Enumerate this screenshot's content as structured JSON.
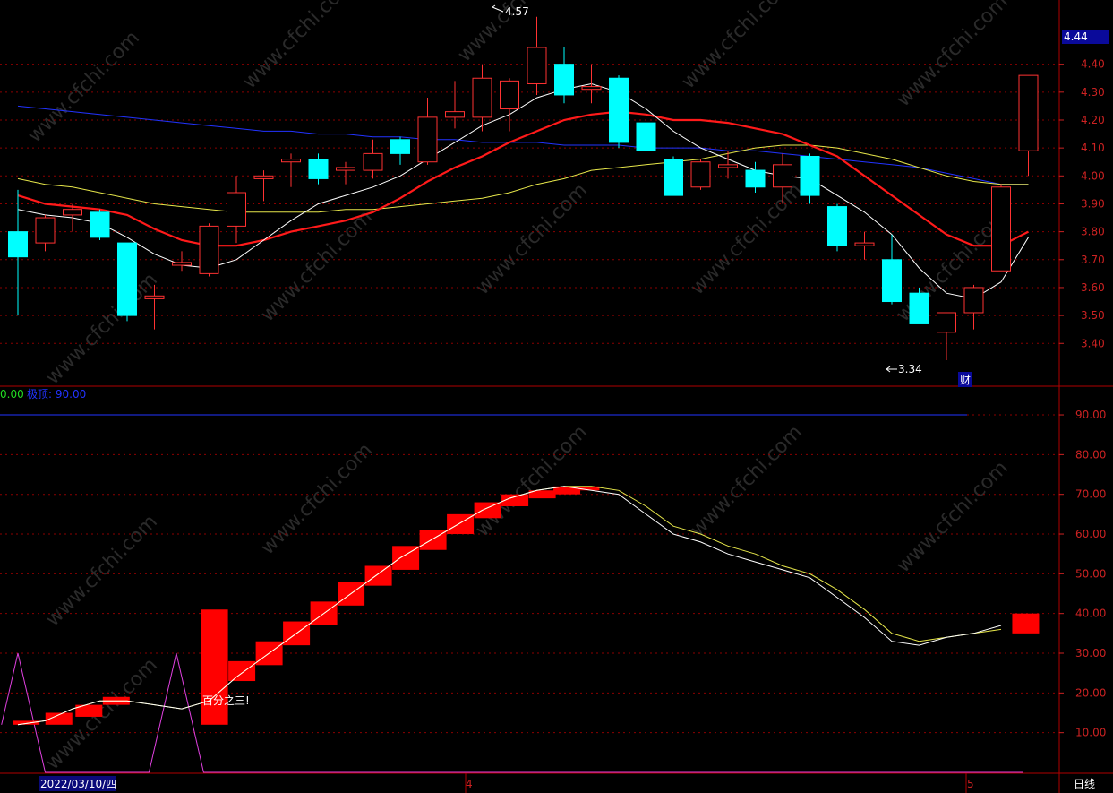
{
  "colors": {
    "background": "#000000",
    "up": "#ff3232",
    "down": "#00ffff",
    "ma_white": "#ffffff",
    "ma_red": "#ff1a1a",
    "ma_yellow": "#e6e64a",
    "ma_blue": "#2233ff",
    "grid": "#8b0000",
    "axis_text": "#cc2222",
    "indicator_line": "#e6e64a",
    "indicator_magenta": "#e040e0",
    "indicator_limit": "#2233ff",
    "bars": "#ff0000"
  },
  "price_panel": {
    "current_price": "4.44",
    "high_marker": "4.57",
    "low_marker": "3.34",
    "finance_badge": "财"
  },
  "indicator_panel": {
    "header_value": "0.00",
    "header_limit_label": "极顶: 90.00",
    "annotation": "百分之三!"
  },
  "bottom_bar": {
    "date_label": "2022/03/10/四",
    "month_4": "4",
    "month_5": "5",
    "period": "日线"
  },
  "chart_data": [
    {
      "type": "candlestick",
      "ylim": [
        3.25,
        4.63
      ],
      "yticks": [
        "4.40",
        "4.30",
        "4.20",
        "4.10",
        "4.00",
        "3.90",
        "3.80",
        "3.70",
        "3.60",
        "3.50",
        "3.40"
      ],
      "candles": [
        {
          "o": 3.8,
          "c": 3.71,
          "h": 3.95,
          "l": 3.5
        },
        {
          "o": 3.76,
          "c": 3.85,
          "h": 3.86,
          "l": 3.73
        },
        {
          "o": 3.86,
          "c": 3.88,
          "h": 3.9,
          "l": 3.8
        },
        {
          "o": 3.87,
          "c": 3.78,
          "h": 3.88,
          "l": 3.77
        },
        {
          "o": 3.76,
          "c": 3.5,
          "h": 3.76,
          "l": 3.48
        },
        {
          "o": 3.56,
          "c": 3.57,
          "h": 3.61,
          "l": 3.45
        },
        {
          "o": 3.68,
          "c": 3.69,
          "h": 3.73,
          "l": 3.66
        },
        {
          "o": 3.65,
          "c": 3.82,
          "h": 3.83,
          "l": 3.64
        },
        {
          "o": 3.82,
          "c": 3.94,
          "h": 4.0,
          "l": 3.76
        },
        {
          "o": 3.99,
          "c": 4.0,
          "h": 4.02,
          "l": 3.91
        },
        {
          "o": 4.05,
          "c": 4.06,
          "h": 4.08,
          "l": 3.96
        },
        {
          "o": 4.06,
          "c": 3.99,
          "h": 4.08,
          "l": 3.97
        },
        {
          "o": 4.02,
          "c": 4.03,
          "h": 4.05,
          "l": 3.97
        },
        {
          "o": 4.02,
          "c": 4.08,
          "h": 4.13,
          "l": 3.99
        },
        {
          "o": 4.13,
          "c": 4.08,
          "h": 4.14,
          "l": 4.04
        },
        {
          "o": 4.05,
          "c": 4.21,
          "h": 4.28,
          "l": 4.04
        },
        {
          "o": 4.21,
          "c": 4.23,
          "h": 4.34,
          "l": 4.17
        },
        {
          "o": 4.21,
          "c": 4.35,
          "h": 4.4,
          "l": 4.16
        },
        {
          "o": 4.24,
          "c": 4.34,
          "h": 4.35,
          "l": 4.16
        },
        {
          "o": 4.33,
          "c": 4.46,
          "h": 4.57,
          "l": 4.29
        },
        {
          "o": 4.4,
          "c": 4.29,
          "h": 4.46,
          "l": 4.26
        },
        {
          "o": 4.31,
          "c": 4.32,
          "h": 4.4,
          "l": 4.26
        },
        {
          "o": 4.35,
          "c": 4.12,
          "h": 4.36,
          "l": 4.1
        },
        {
          "o": 4.19,
          "c": 4.09,
          "h": 4.2,
          "l": 4.06
        },
        {
          "o": 4.06,
          "c": 3.93,
          "h": 4.07,
          "l": 3.93
        },
        {
          "o": 3.96,
          "c": 4.05,
          "h": 4.06,
          "l": 3.95
        },
        {
          "o": 4.03,
          "c": 4.04,
          "h": 4.09,
          "l": 3.99
        },
        {
          "o": 4.02,
          "c": 3.96,
          "h": 4.05,
          "l": 3.94
        },
        {
          "o": 3.96,
          "c": 4.04,
          "h": 4.08,
          "l": 3.9
        },
        {
          "o": 4.07,
          "c": 3.93,
          "h": 4.08,
          "l": 3.9
        },
        {
          "o": 3.89,
          "c": 3.75,
          "h": 3.9,
          "l": 3.73
        },
        {
          "o": 3.75,
          "c": 3.76,
          "h": 3.8,
          "l": 3.7
        },
        {
          "o": 3.7,
          "c": 3.55,
          "h": 3.79,
          "l": 3.54
        },
        {
          "o": 3.58,
          "c": 3.47,
          "h": 3.6,
          "l": 3.47
        },
        {
          "o": 3.44,
          "c": 3.51,
          "h": 3.51,
          "l": 3.34
        },
        {
          "o": 3.51,
          "c": 3.6,
          "h": 3.61,
          "l": 3.45
        },
        {
          "o": 3.66,
          "c": 3.96,
          "h": 3.97,
          "l": 3.66
        },
        {
          "o": 4.09,
          "c": 4.36,
          "h": 4.36,
          "l": 4.0
        }
      ],
      "ma_white": [
        3.88,
        3.86,
        3.85,
        3.83,
        3.78,
        3.72,
        3.68,
        3.67,
        3.7,
        3.77,
        3.84,
        3.9,
        3.93,
        3.96,
        4.0,
        4.06,
        4.12,
        4.18,
        4.22,
        4.28,
        4.31,
        4.33,
        4.3,
        4.24,
        4.16,
        4.1,
        4.06,
        4.02,
        4.0,
        3.99,
        3.93,
        3.87,
        3.79,
        3.67,
        3.58,
        3.56,
        3.62,
        3.78
      ],
      "ma_red": [
        3.93,
        3.9,
        3.89,
        3.88,
        3.86,
        3.81,
        3.77,
        3.75,
        3.75,
        3.77,
        3.8,
        3.82,
        3.84,
        3.87,
        3.92,
        3.98,
        4.03,
        4.07,
        4.12,
        4.16,
        4.2,
        4.22,
        4.23,
        4.22,
        4.2,
        4.2,
        4.19,
        4.17,
        4.15,
        4.11,
        4.07,
        4.0,
        3.93,
        3.86,
        3.79,
        3.75,
        3.75,
        3.8
      ],
      "ma_yellow": [
        3.99,
        3.97,
        3.96,
        3.94,
        3.92,
        3.9,
        3.89,
        3.88,
        3.87,
        3.87,
        3.87,
        3.87,
        3.88,
        3.88,
        3.89,
        3.9,
        3.91,
        3.92,
        3.94,
        3.97,
        3.99,
        4.02,
        4.03,
        4.04,
        4.05,
        4.06,
        4.08,
        4.1,
        4.11,
        4.11,
        4.1,
        4.08,
        4.06,
        4.03,
        4.0,
        3.98,
        3.97,
        3.97
      ],
      "ma_blue": [
        4.25,
        4.24,
        4.23,
        4.22,
        4.21,
        4.2,
        4.19,
        4.18,
        4.17,
        4.16,
        4.16,
        4.15,
        4.15,
        4.14,
        4.14,
        4.13,
        4.13,
        4.12,
        4.12,
        4.12,
        4.11,
        4.11,
        4.11,
        4.1,
        4.1,
        4.1,
        4.09,
        4.09,
        4.08,
        4.07,
        4.06,
        4.05,
        4.04,
        4.03,
        4.01,
        3.99,
        3.97,
        3.97
      ]
    },
    {
      "type": "bar",
      "ylim": [
        0,
        97
      ],
      "yticks": [
        "90.00",
        "80.00",
        "70.00",
        "60.00",
        "50.00",
        "40.00",
        "30.00",
        "20.00",
        "10.00"
      ],
      "limit_line": 90,
      "blocks": [
        {
          "i": 0.3,
          "lo": 12,
          "hi": 13
        },
        {
          "i": 1.5,
          "lo": 12,
          "hi": 15
        },
        {
          "i": 2.6,
          "lo": 14,
          "hi": 17
        },
        {
          "i": 3.6,
          "lo": 17,
          "hi": 19
        },
        {
          "i": 7.2,
          "lo": 12,
          "hi": 41
        },
        {
          "i": 8.2,
          "lo": 23,
          "hi": 28
        },
        {
          "i": 9.2,
          "lo": 27,
          "hi": 33
        },
        {
          "i": 10.2,
          "lo": 32,
          "hi": 38
        },
        {
          "i": 11.2,
          "lo": 37,
          "hi": 43
        },
        {
          "i": 12.2,
          "lo": 42,
          "hi": 48
        },
        {
          "i": 13.2,
          "lo": 47,
          "hi": 52
        },
        {
          "i": 14.2,
          "lo": 51,
          "hi": 57
        },
        {
          "i": 15.2,
          "lo": 56,
          "hi": 61
        },
        {
          "i": 16.2,
          "lo": 60,
          "hi": 65
        },
        {
          "i": 17.2,
          "lo": 64,
          "hi": 68
        },
        {
          "i": 18.2,
          "lo": 67,
          "hi": 70
        },
        {
          "i": 19.2,
          "lo": 69,
          "hi": 71
        },
        {
          "i": 20.1,
          "lo": 70,
          "hi": 72
        },
        {
          "i": 20.8,
          "lo": 71,
          "hi": 72
        },
        {
          "i": 36.9,
          "lo": 35,
          "hi": 40
        }
      ],
      "line_white": [
        12,
        13,
        16,
        18,
        18,
        17,
        16,
        18,
        24,
        29,
        34,
        39,
        44,
        49,
        54,
        58,
        62,
        66,
        69,
        71,
        72,
        71,
        70,
        65,
        60,
        58,
        55,
        53,
        51,
        49,
        44,
        39,
        33,
        32,
        34,
        35,
        37
      ],
      "line_yellow": [
        12,
        13,
        16,
        18,
        18,
        17,
        16,
        18,
        24,
        29,
        34,
        39,
        44,
        49,
        54,
        58,
        62,
        66,
        69,
        71,
        72,
        72,
        71,
        67,
        62,
        60,
        57,
        55,
        52,
        50,
        46,
        41,
        35,
        33,
        34,
        35,
        36
      ],
      "magenta": [
        {
          "i": -0.6,
          "v": 12
        },
        {
          "i": 0.0,
          "v": 30
        },
        {
          "i": 1.0,
          "v": 0
        },
        {
          "i": 4.8,
          "v": 0
        },
        {
          "i": 5.8,
          "v": 30
        },
        {
          "i": 6.8,
          "v": 0
        },
        {
          "i": 36.8,
          "v": 0
        }
      ]
    }
  ]
}
